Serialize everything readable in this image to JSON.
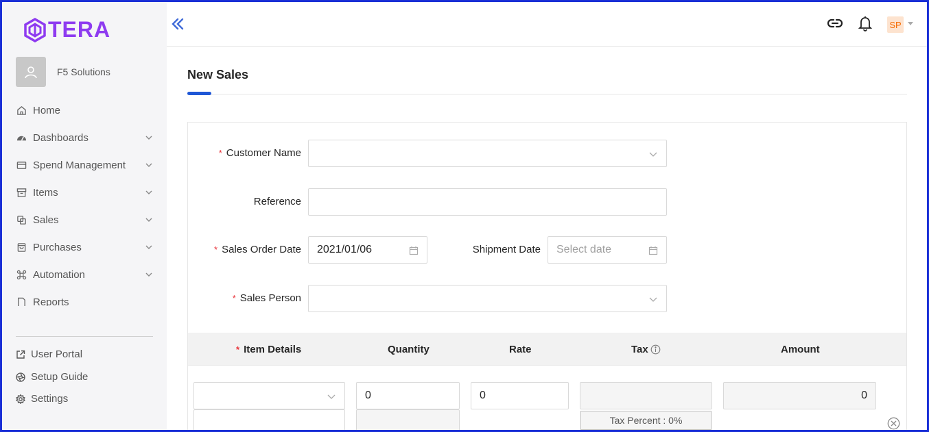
{
  "brand": {
    "logo_text": "TERA",
    "accent": "#8e3bf0"
  },
  "org": {
    "name": "F5 Solutions"
  },
  "nav": {
    "items": [
      {
        "label": "Home",
        "icon": "home-icon",
        "has_children": false
      },
      {
        "label": "Dashboards",
        "icon": "dashboard-icon",
        "has_children": true
      },
      {
        "label": "Spend Management",
        "icon": "credit-card-icon",
        "has_children": true
      },
      {
        "label": "Items",
        "icon": "inbox-icon",
        "has_children": true
      },
      {
        "label": "Sales",
        "icon": "copy-icon",
        "has_children": true
      },
      {
        "label": "Purchases",
        "icon": "shopping-bag-icon",
        "has_children": true
      },
      {
        "label": "Automation",
        "icon": "command-icon",
        "has_children": true
      },
      {
        "label": "Reports",
        "icon": "file-icon",
        "has_children": false
      }
    ]
  },
  "footer_nav": {
    "user_portal": "User Portal",
    "setup_guide": "Setup Guide",
    "settings": "Settings"
  },
  "topbar": {
    "user_initials": "SP"
  },
  "page": {
    "title": "New Sales"
  },
  "form": {
    "customer_name": {
      "label": "Customer Name",
      "value": ""
    },
    "reference": {
      "label": "Reference",
      "value": ""
    },
    "sales_order_date": {
      "label": "Sales Order Date",
      "value": "2021/01/06"
    },
    "shipment_date": {
      "label": "Shipment Date",
      "placeholder": "Select date"
    },
    "sales_person": {
      "label": "Sales Person",
      "value": ""
    }
  },
  "table": {
    "headers": {
      "item_details": "Item Details",
      "quantity": "Quantity",
      "rate": "Rate",
      "tax": "Tax",
      "amount": "Amount"
    },
    "row": {
      "quantity": "0",
      "rate": "0",
      "amount": "0",
      "tax_percent": "Tax Percent : 0%"
    }
  },
  "colors": {
    "primary": "#1f57d6",
    "required": "#e8333a",
    "frame": "#1a2fd6"
  }
}
